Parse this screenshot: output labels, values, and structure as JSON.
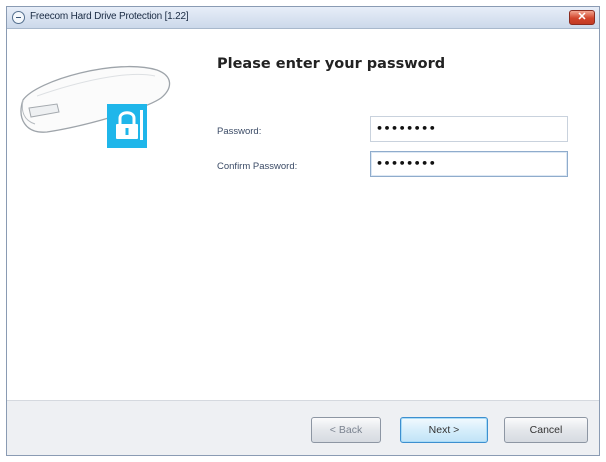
{
  "window": {
    "title": "Freecom Hard Drive Protection [1.22]",
    "close_glyph": "✕"
  },
  "page": {
    "heading": "Please enter your password",
    "password_label": "Password:",
    "password_value": "••••••••",
    "confirm_label": "Confirm Password:",
    "confirm_value": "••••••••"
  },
  "buttons": {
    "back": "< Back",
    "next": "Next >",
    "cancel": "Cancel"
  },
  "icons": {
    "app": "app-icon",
    "drive": "hard-drive-icon",
    "lock": "lock-icon"
  },
  "colors": {
    "lock_accent": "#1fb6ea",
    "close": "#d2452c",
    "title_bar": "#ccd9ea"
  }
}
